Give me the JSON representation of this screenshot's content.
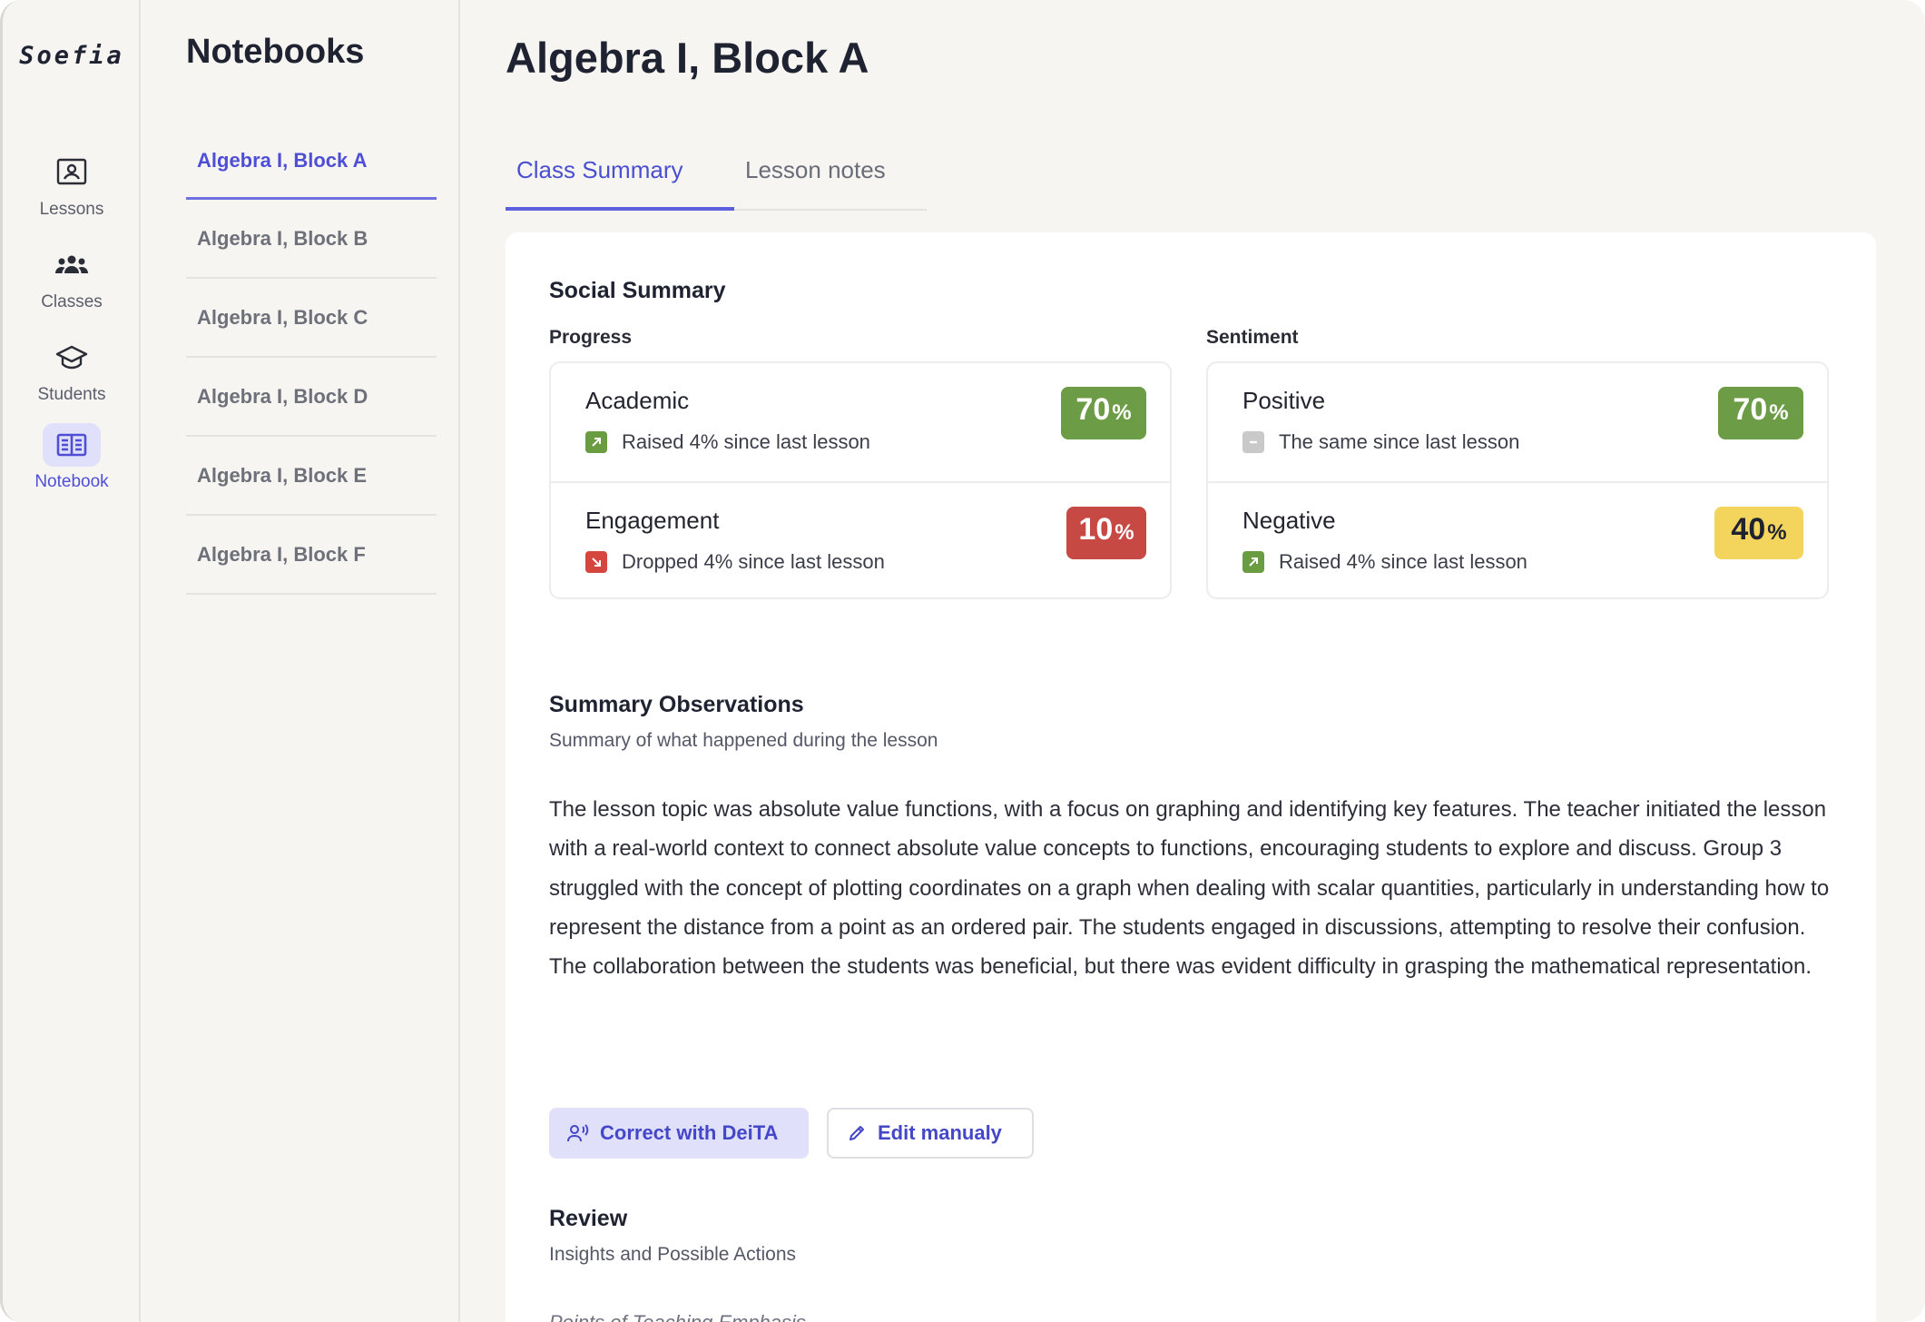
{
  "app": {
    "logo": "Soefia"
  },
  "rail": {
    "items": [
      {
        "label": "Lessons",
        "icon": "lessons-icon"
      },
      {
        "label": "Classes",
        "icon": "classes-icon"
      },
      {
        "label": "Students",
        "icon": "students-icon"
      },
      {
        "label": "Notebook",
        "icon": "notebook-icon",
        "active": true
      }
    ]
  },
  "notebooks": {
    "title": "Notebooks",
    "items": [
      {
        "label": "Algebra I, Block A",
        "active": true
      },
      {
        "label": "Algebra I, Block B"
      },
      {
        "label": "Algebra I, Block C"
      },
      {
        "label": "Algebra I, Block D"
      },
      {
        "label": "Algebra I, Block E"
      },
      {
        "label": "Algebra I, Block F"
      }
    ]
  },
  "main": {
    "title": "Algebra I, Block A",
    "tabs": [
      {
        "label": "Class Summary",
        "active": true
      },
      {
        "label": "Lesson notes"
      }
    ]
  },
  "social_summary": {
    "title": "Social Summary",
    "progress": {
      "label": "Progress",
      "metrics": [
        {
          "name": "Academic",
          "change": "Raised 4% since last lesson",
          "trend": "up",
          "value": "70",
          "unit": "%",
          "color": "#6c9c45"
        },
        {
          "name": "Engagement",
          "change": "Dropped 4% since last lesson",
          "trend": "down",
          "value": "10",
          "unit": "%",
          "color": "#c74943"
        }
      ]
    },
    "sentiment": {
      "label": "Sentiment",
      "metrics": [
        {
          "name": "Positive",
          "change": "The same since last lesson",
          "trend": "same",
          "value": "70",
          "unit": "%",
          "color": "#6c9c45"
        },
        {
          "name": "Negative",
          "change": "Raised 4% since last lesson",
          "trend": "up",
          "value": "40",
          "unit": "%",
          "color": "#f3d55d"
        }
      ]
    }
  },
  "observations": {
    "title": "Summary Observations",
    "subtitle": "Summary of what happened during the lesson",
    "body": "The lesson topic was absolute value functions, with a focus on graphing and identifying key features. The teacher initiated the lesson with a real-world context to connect absolute value concepts to functions, encouraging students to explore and discuss. Group 3 struggled with the concept of plotting coordinates on a graph when dealing with scalar quantities, particularly in understanding how to represent the distance from a point as an ordered pair. The students engaged in discussions, attempting to resolve their confusion. The collaboration between the students was beneficial, but there was evident difficulty in grasping the mathematical representation.",
    "primary_button": "Correct with DeiTA",
    "secondary_button": "Edit manualy"
  },
  "review": {
    "title": "Review",
    "subtitle": "Insights and Possible Actions",
    "next_heading": "Points of Teaching Emphasis"
  }
}
